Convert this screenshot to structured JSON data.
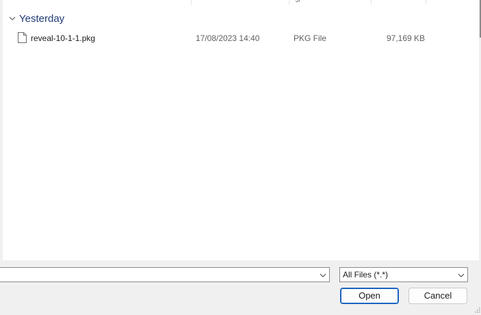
{
  "file_list": {
    "groups": [
      {
        "label": "Yesterday",
        "files": [
          {
            "name": "reveal-10-1-1.pkg",
            "date_modified": "17/08/2023 14:40",
            "type": "PKG File",
            "size": "97,169 KB",
            "icon": "generic-file-icon"
          }
        ]
      }
    ]
  },
  "footer": {
    "file_name_value": "",
    "file_type_selected": "All Files (*.*)",
    "open_label": "Open",
    "cancel_label": "Cancel"
  },
  "colors": {
    "group_header": "#1e3b78",
    "primary_button_border": "#1a62c3",
    "pane_background": "#ffffff",
    "chrome_background": "#f0f0f0"
  }
}
